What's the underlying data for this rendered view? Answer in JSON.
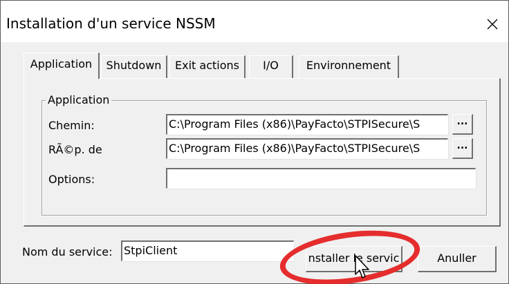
{
  "window": {
    "title": "Installation d'un service NSSM",
    "close_glyph": "✕"
  },
  "tabs": [
    {
      "label": "Application",
      "active": true
    },
    {
      "label": "Shutdown",
      "active": false
    },
    {
      "label": "Exit actions",
      "active": false
    },
    {
      "label": "I/O",
      "active": false
    },
    {
      "label": "Environnement",
      "active": false
    }
  ],
  "application_group": {
    "legend": "Application",
    "path": {
      "label": "Chemin:",
      "value": "C:\\Program Files (x86)\\PayFacto\\STPISecure\\S"
    },
    "startup_dir": {
      "label": "RÃ©p. de",
      "value": "C:\\Program Files (x86)\\PayFacto\\STPISecure\\S"
    },
    "options": {
      "label": "Options:",
      "value": ""
    },
    "browse_label": "..."
  },
  "footer": {
    "service_name_label": "Nom du service:",
    "service_name_value": "StpiClient",
    "install_button": "nstaller le servic",
    "cancel_button": "Anuller"
  },
  "colors": {
    "annotation": "#e52d2d",
    "window_bg": "#f0f0f0"
  },
  "icons": {
    "close": "close-icon",
    "cursor": "mouse-pointer-icon"
  }
}
